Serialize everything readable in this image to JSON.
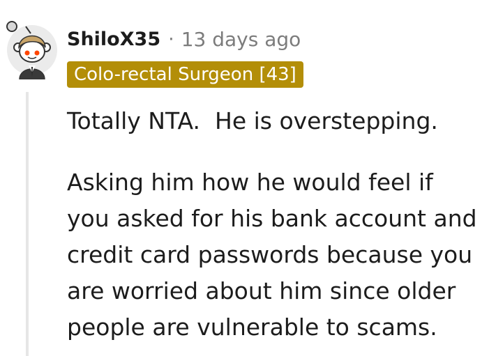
{
  "comment": {
    "username": "ShiloX35",
    "separator": "·",
    "timestamp": "13 days ago",
    "flair": "Colo-rectal Surgeon [43]",
    "paragraphs": [
      "Totally NTA.  He is overstepping.",
      "Asking him how he would feel if\nyou asked for his bank account and\ncredit card passwords because you\nare worried about him since older\npeople are vulnerable to scams."
    ],
    "avatar_icon": "reddit-snoo-avatar-icon"
  },
  "colors": {
    "flair_bg": "#b38e08",
    "flair_text": "#ffffff",
    "meta_text": "#7c7c7c",
    "body_text": "#1c1c1c",
    "thread_line": "#e6e6e6"
  }
}
